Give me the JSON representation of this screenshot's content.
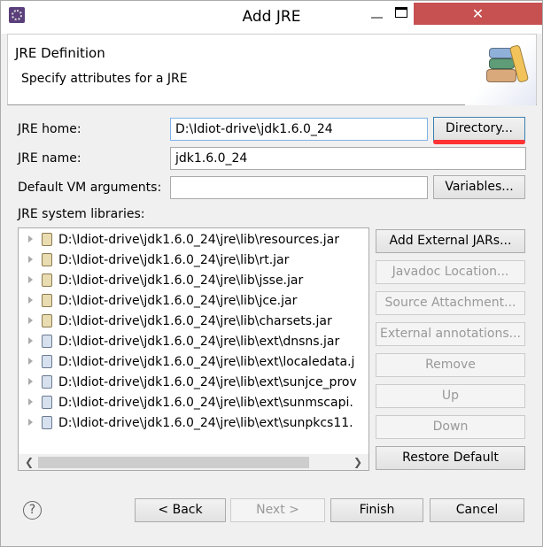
{
  "window": {
    "title": "Add JRE",
    "close_glyph": "✕"
  },
  "header": {
    "title": "JRE Definition",
    "subtitle": "Specify attributes for a JRE",
    "icon": "library-books-icon"
  },
  "form": {
    "jre_home_label": "JRE home:",
    "jre_home_value": "D:\\Idiot-drive\\jdk1.6.0_24",
    "directory_button": "Directory...",
    "jre_name_label": "JRE name:",
    "jre_name_value": "jdk1.6.0_24",
    "vm_args_label": "Default VM arguments:",
    "vm_args_value": "",
    "variables_button": "Variables...",
    "libraries_label": "JRE system libraries:"
  },
  "libraries": [
    {
      "path": "D:\\Idiot-drive\\jdk1.6.0_24\\jre\\lib\\resources.jar",
      "type": "lib"
    },
    {
      "path": "D:\\Idiot-drive\\jdk1.6.0_24\\jre\\lib\\rt.jar",
      "type": "lib"
    },
    {
      "path": "D:\\Idiot-drive\\jdk1.6.0_24\\jre\\lib\\jsse.jar",
      "type": "lib"
    },
    {
      "path": "D:\\Idiot-drive\\jdk1.6.0_24\\jre\\lib\\jce.jar",
      "type": "lib"
    },
    {
      "path": "D:\\Idiot-drive\\jdk1.6.0_24\\jre\\lib\\charsets.jar",
      "type": "lib"
    },
    {
      "path": "D:\\Idiot-drive\\jdk1.6.0_24\\jre\\lib\\ext\\dnsns.jar",
      "type": "ext"
    },
    {
      "path": "D:\\Idiot-drive\\jdk1.6.0_24\\jre\\lib\\ext\\localedata.j",
      "type": "ext"
    },
    {
      "path": "D:\\Idiot-drive\\jdk1.6.0_24\\jre\\lib\\ext\\sunjce_prov",
      "type": "ext"
    },
    {
      "path": "D:\\Idiot-drive\\jdk1.6.0_24\\jre\\lib\\ext\\sunmscapi.",
      "type": "ext"
    },
    {
      "path": "D:\\Idiot-drive\\jdk1.6.0_24\\jre\\lib\\ext\\sunpkcs11.",
      "type": "ext"
    }
  ],
  "side_buttons": [
    {
      "label": "Add External JARs...",
      "enabled": true
    },
    {
      "label": "Javadoc Location...",
      "enabled": false
    },
    {
      "label": "Source Attachment...",
      "enabled": false
    },
    {
      "label": "External annotations...",
      "enabled": false
    },
    {
      "label": "Remove",
      "enabled": false
    },
    {
      "label": "Up",
      "enabled": false
    },
    {
      "label": "Down",
      "enabled": false
    },
    {
      "label": "Restore Default",
      "enabled": true
    }
  ],
  "footer": {
    "help": "?",
    "back": "< Back",
    "next": "Next >",
    "finish": "Finish",
    "cancel": "Cancel"
  },
  "colors": {
    "close": "#c75050",
    "annotation_underline": "#ff3333"
  }
}
